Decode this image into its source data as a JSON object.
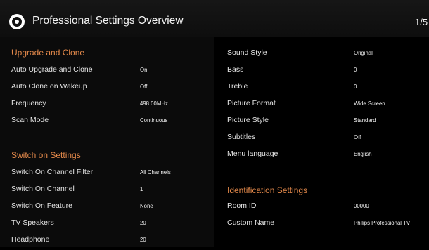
{
  "header": {
    "title": "Professional Settings Overview",
    "page_indicator": "1/5"
  },
  "colors": {
    "section_heading": "#e2884a",
    "background": "#000000"
  },
  "left_panel": {
    "upgrade_heading": "Upgrade and Clone",
    "upgrade_items": [
      {
        "label": "Auto Upgrade and Clone",
        "value": "On"
      },
      {
        "label": "Auto Clone on Wakeup",
        "value": "Off"
      },
      {
        "label": "Frequency",
        "value": "498.00MHz"
      },
      {
        "label": "Scan Mode",
        "value": "Continuous"
      }
    ],
    "switch_heading": "Switch on Settings",
    "switch_items": [
      {
        "label": "Switch On Channel Filter",
        "value": "All Channels"
      },
      {
        "label": "Switch On Channel",
        "value": "1"
      },
      {
        "label": "Switch On Feature",
        "value": "None"
      },
      {
        "label": "TV Speakers",
        "value": "20"
      },
      {
        "label": "Headphone",
        "value": "20"
      }
    ]
  },
  "right_panel": {
    "picture_items": [
      {
        "label": "Sound Style",
        "value": "Original"
      },
      {
        "label": "Bass",
        "value": "0"
      },
      {
        "label": "Treble",
        "value": "0"
      },
      {
        "label": "Picture Format",
        "value": "Wide Screen"
      },
      {
        "label": "Picture Style",
        "value": "Standard"
      },
      {
        "label": "Subtitles",
        "value": "Off"
      },
      {
        "label": "Menu language",
        "value": "English"
      }
    ],
    "identification_heading": "Identification Settings",
    "identification_items": [
      {
        "label": "Room ID",
        "value": "00000"
      },
      {
        "label": "Custom Name",
        "value": "Philips Professional TV"
      }
    ]
  }
}
